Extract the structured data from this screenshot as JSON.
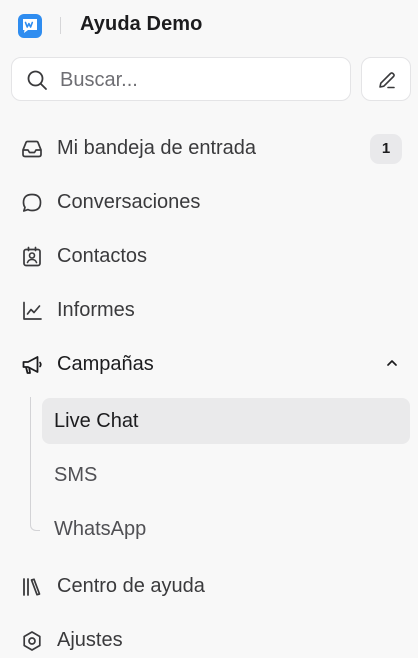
{
  "header": {
    "logo_icon": "chatwoot-logo-icon",
    "workspace_name": "Ayuda Demo",
    "accent_color": "#2f8df0"
  },
  "search": {
    "placeholder": "Buscar...",
    "value": "",
    "icon": "search-icon"
  },
  "compose": {
    "icon": "pencil-icon"
  },
  "nav": {
    "inbox": {
      "label": "Mi bandeja de entrada",
      "icon": "inbox-icon",
      "badge": "1"
    },
    "conversations": {
      "label": "Conversaciones",
      "icon": "chat-bubble-icon"
    },
    "contacts": {
      "label": "Contactos",
      "icon": "contact-card-icon"
    },
    "reports": {
      "label": "Informes",
      "icon": "line-chart-icon"
    },
    "campaigns": {
      "label": "Campañas",
      "icon": "megaphone-icon",
      "expanded": true,
      "children": [
        {
          "label": "Live Chat",
          "active": true
        },
        {
          "label": "SMS",
          "active": false
        },
        {
          "label": "WhatsApp",
          "active": false
        }
      ]
    },
    "help_center": {
      "label": "Centro de ayuda",
      "icon": "library-icon"
    },
    "settings": {
      "label": "Ajustes",
      "icon": "settings-hexagon-icon"
    }
  }
}
